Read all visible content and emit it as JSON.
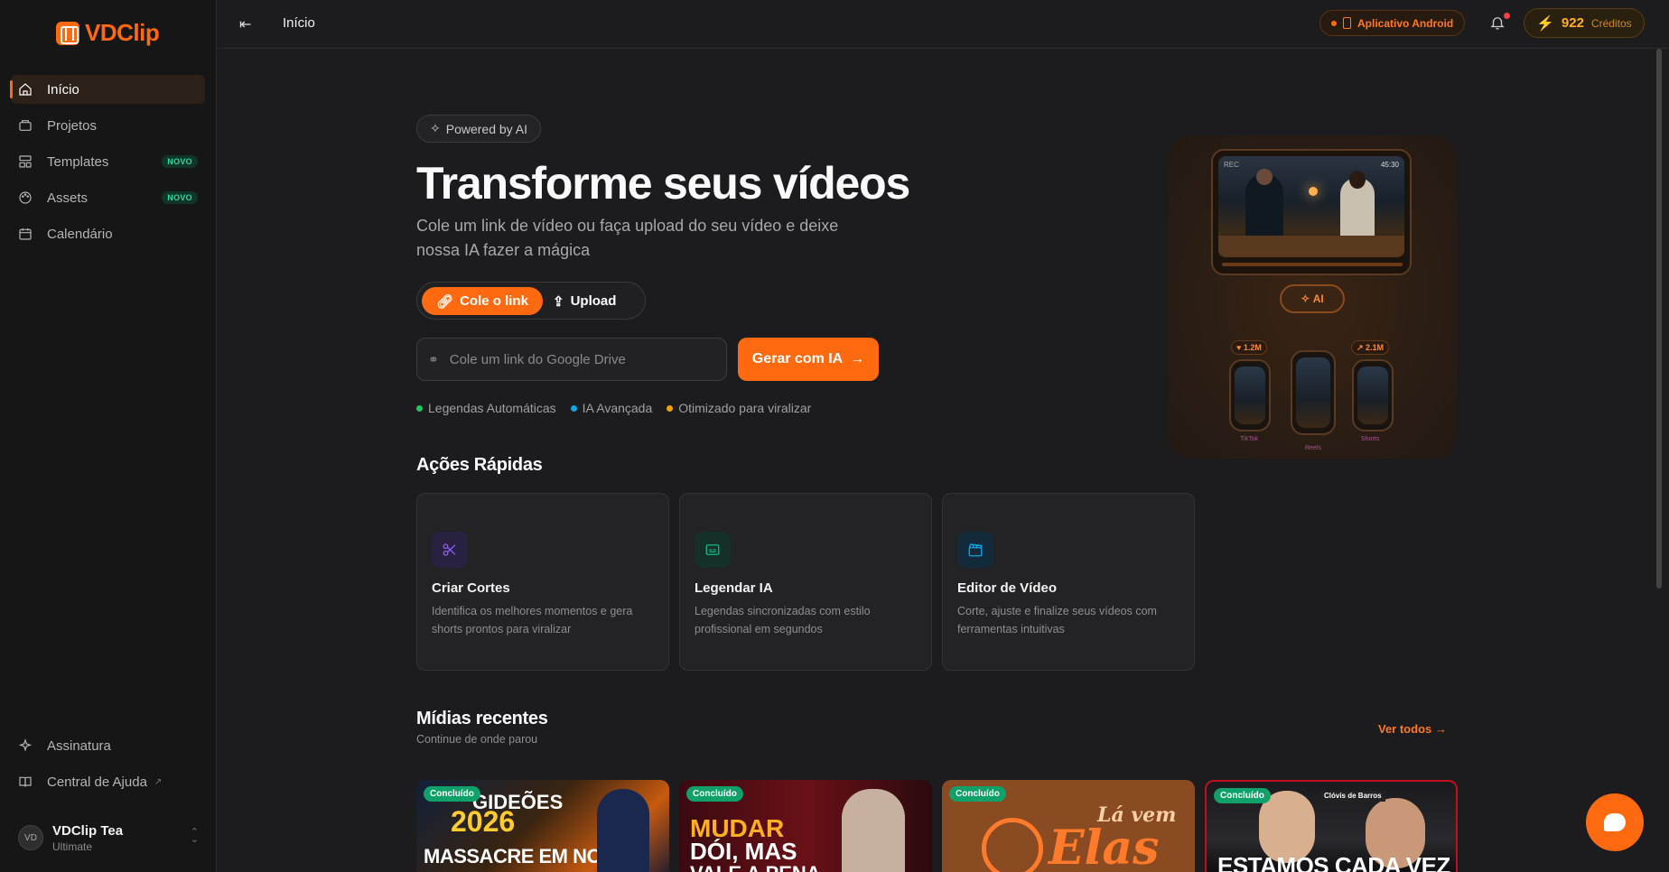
{
  "app": {
    "name": "VDClip",
    "accent": "#ff6a10"
  },
  "sidebar": {
    "items": [
      {
        "label": "Início",
        "icon": "home-icon",
        "active": true
      },
      {
        "label": "Projetos",
        "icon": "folder-icon"
      },
      {
        "label": "Templates",
        "icon": "layout-icon",
        "badge": "NOVO"
      },
      {
        "label": "Assets",
        "icon": "palette-icon",
        "badge": "NOVO"
      },
      {
        "label": "Calendário",
        "icon": "calendar-icon"
      }
    ],
    "bottom": [
      {
        "label": "Assinatura",
        "icon": "sparkles-icon"
      },
      {
        "label": "Central de Ajuda",
        "icon": "book-icon",
        "external": "↗"
      }
    ],
    "user": {
      "initials": "VD",
      "name": "VDClip Tea",
      "plan": "Ultimate"
    }
  },
  "header": {
    "breadcrumb": "Início",
    "android_label": "Aplicativo Android",
    "credits_value": "922",
    "credits_label": "Créditos"
  },
  "hero": {
    "powered": "Powered by AI",
    "title": "Transforme seus vídeos",
    "subtitle": "Cole um link de vídeo ou faça upload do seu vídeo e deixe nossa IA fazer a mágica",
    "mode_link": "Cole o link",
    "mode_upload": "Upload",
    "input_placeholder": "Cole um link do Google Drive",
    "generate_label": "Gerar com IA",
    "features": [
      {
        "label": "Legendas Automáticas",
        "color": "#22c55e"
      },
      {
        "label": "IA Avançada",
        "color": "#0ea5e9"
      },
      {
        "label": "Otimizado para viralizar",
        "color": "#f59e0b"
      }
    ],
    "illustration": {
      "time": "45:30",
      "ai_label": "AI",
      "stats": [
        "1.2M",
        "2.1M"
      ],
      "platforms": [
        "TikTok",
        "Reels",
        "Shorts"
      ]
    }
  },
  "quick_actions": {
    "title": "Ações Rápidas",
    "cards": [
      {
        "title": "Criar Cortes",
        "desc": "Identifica os melhores momentos e gera shorts prontos para viralizar",
        "icon": "scissors-icon",
        "color": "#8b5cf6"
      },
      {
        "title": "Legendar IA",
        "desc": "Legendas sincronizadas com estilo profissional em segundos",
        "icon": "captions-icon",
        "color": "#10b981"
      },
      {
        "title": "Editor de Vídeo",
        "desc": "Corte, ajuste e finalize seus vídeos com ferramentas intuitivas",
        "icon": "clapperboard-icon",
        "color": "#0ea5e9"
      }
    ]
  },
  "recent": {
    "title": "Mídias recentes",
    "subtitle": "Continue de onde parou",
    "view_all": "Ver todos",
    "items": [
      {
        "status": "Concluído",
        "line1": "GIDEÕES",
        "line2": "2026",
        "line3": "MASSACRE EM NOBE"
      },
      {
        "status": "Concluído",
        "line1": "MUDAR",
        "line2": "DÓI, MAS",
        "line3": "VALE A PENA"
      },
      {
        "status": "Concluído",
        "line1": "Elas",
        "line2": "Lá vem"
      },
      {
        "status": "Concluído",
        "line1": "Clóvis de Barros",
        "line2": "ESTAMOS CADA VEZ"
      }
    ]
  }
}
